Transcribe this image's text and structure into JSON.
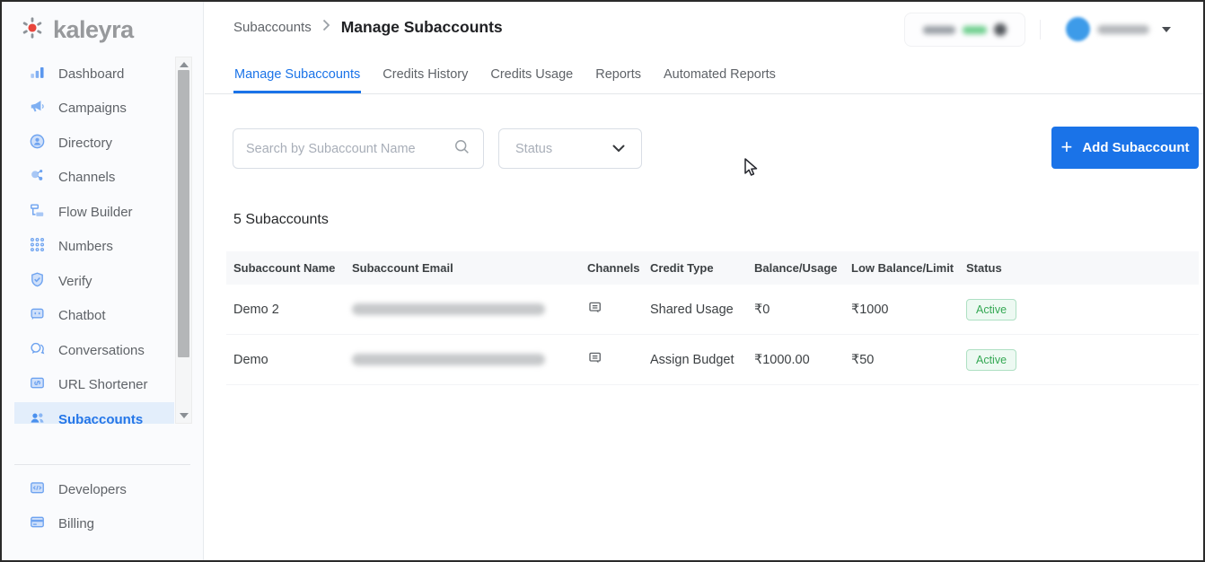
{
  "brand": {
    "name": "kaleyra",
    "logo_red": "#e8453c",
    "logo_gray": "#97999c"
  },
  "sidebar": {
    "items": [
      {
        "label": "Dashboard"
      },
      {
        "label": "Campaigns"
      },
      {
        "label": "Directory"
      },
      {
        "label": "Channels"
      },
      {
        "label": "Flow Builder"
      },
      {
        "label": "Numbers"
      },
      {
        "label": "Verify"
      },
      {
        "label": "Chatbot"
      },
      {
        "label": "Conversations"
      },
      {
        "label": "URL Shortener"
      },
      {
        "label": "Subaccounts"
      }
    ],
    "active_item": "Subaccounts",
    "footer_items": [
      {
        "label": "Developers"
      },
      {
        "label": "Billing"
      }
    ]
  },
  "header": {
    "breadcrumb": {
      "parent": "Subaccounts",
      "current": "Manage Subaccounts"
    },
    "account": {
      "usage_pill_redacted": true,
      "user_name_redacted": true,
      "avatar_color": "#3d9be9"
    }
  },
  "tabs": [
    {
      "label": "Manage Subaccounts",
      "active": true
    },
    {
      "label": "Credits History",
      "active": false
    },
    {
      "label": "Credits Usage",
      "active": false
    },
    {
      "label": "Reports",
      "active": false
    },
    {
      "label": "Automated Reports",
      "active": false
    }
  ],
  "toolbar": {
    "search_placeholder": "Search by Subaccount Name",
    "search_value": "",
    "status_placeholder": "Status",
    "add_button_label": "Add Subaccount",
    "add_button_color": "#1a73e8"
  },
  "table": {
    "count_label": "5 Subaccounts",
    "columns": [
      "Subaccount Name",
      "Subaccount Email",
      "Channels",
      "Credit Type",
      "Balance/Usage",
      "Low Balance/Limit",
      "Status"
    ],
    "rows": [
      {
        "name": "Demo 2",
        "email_redacted": true,
        "channels_icon": "message-square",
        "credit_type": "Shared Usage",
        "balance_usage": "₹0",
        "low_balance_limit": "₹1000",
        "status": "Active"
      },
      {
        "name": "Demo",
        "email_redacted": true,
        "channels_icon": "message-square",
        "credit_type": "Assign Budget",
        "balance_usage": "₹1000.00",
        "low_balance_limit": "₹50",
        "status": "Active"
      }
    ],
    "status_colors": {
      "active_text": "#34a853",
      "active_bg": "#edf9f2",
      "active_border": "#aee0c3"
    }
  }
}
